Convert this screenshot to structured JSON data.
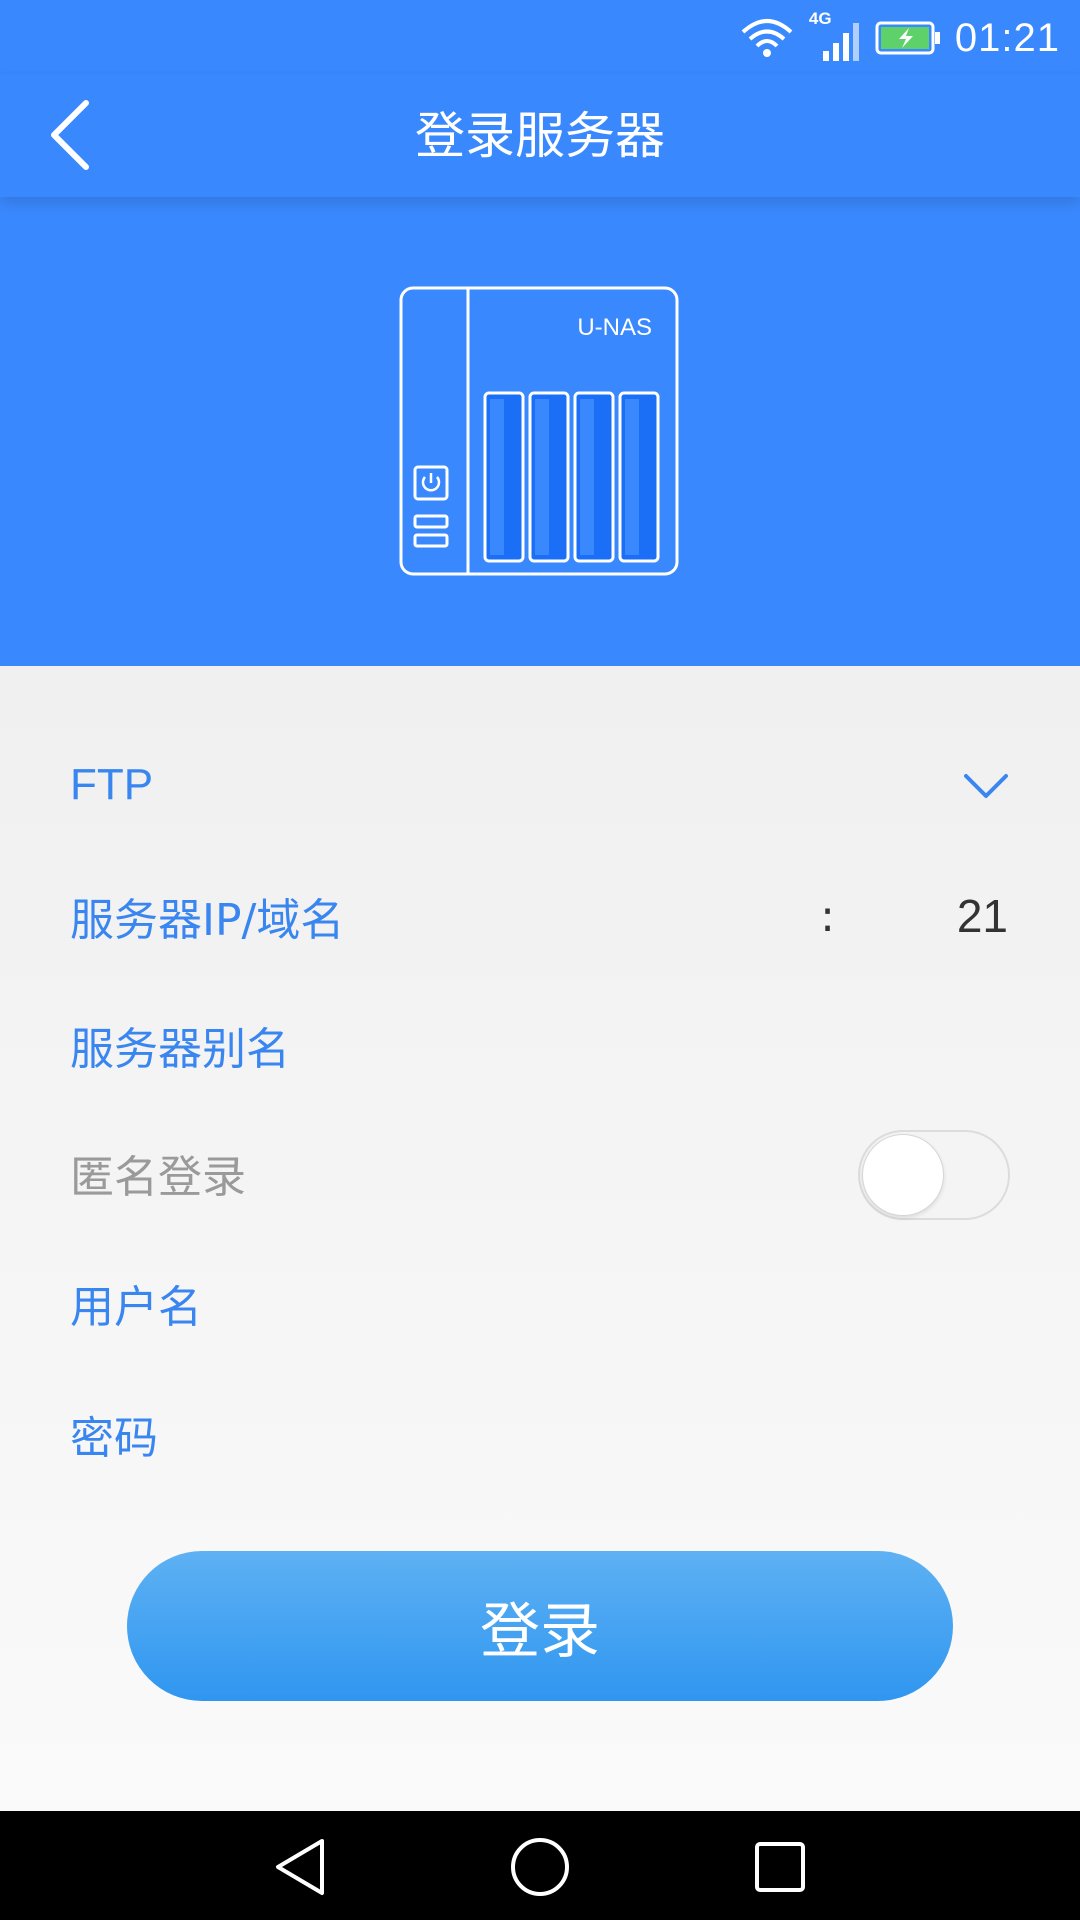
{
  "status_bar": {
    "network": "4G",
    "time": "01:21",
    "icons": [
      "wifi-icon",
      "signal-icon",
      "battery-charging-icon"
    ]
  },
  "header": {
    "title": "登录服务器",
    "back_icon": "chevron-left-icon"
  },
  "device": {
    "label": "U-NAS"
  },
  "form": {
    "protocol": "FTP",
    "server_ip_label": "服务器IP/域名",
    "port_separator": ":",
    "port": "21",
    "alias_label": "服务器别名",
    "anonymous_label": "匿名登录",
    "anonymous_enabled": false,
    "username_label": "用户名",
    "password_label": "密码"
  },
  "login_button": "登录",
  "nav_bar": {
    "icons": [
      "back-triangle-icon",
      "home-circle-icon",
      "recents-square-icon"
    ]
  },
  "colors": {
    "primary": "#3a88fd",
    "text_blue": "#3a86f0",
    "text_muted": "#9a9a9a"
  }
}
